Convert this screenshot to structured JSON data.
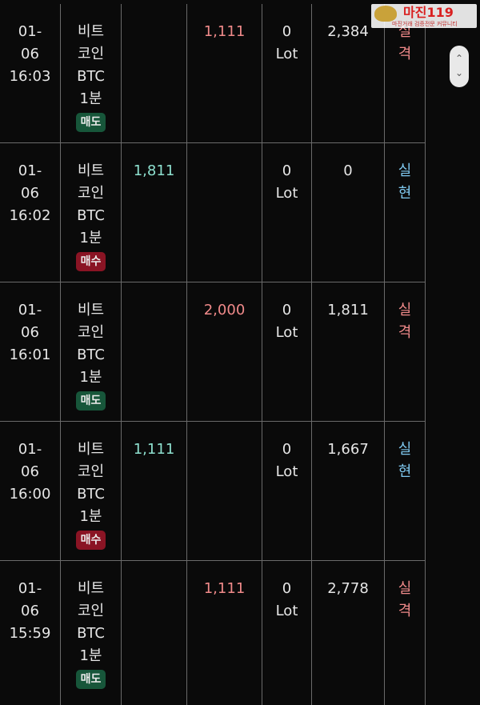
{
  "watermark": {
    "title": "마진119",
    "subtitle": "마진거래 검증전문 커뮤니티"
  },
  "rows": [
    {
      "time": [
        "01-",
        "06",
        "16:03"
      ],
      "name": [
        "비트",
        "코인",
        "BTC",
        "1분"
      ],
      "badge": "매도",
      "buy": "",
      "sell": "1,111",
      "lot": [
        "0",
        "Lot"
      ],
      "amount": "2,384",
      "result": [
        "실",
        "격"
      ]
    },
    {
      "time": [
        "01-",
        "06",
        "16:02"
      ],
      "name": [
        "비트",
        "코인",
        "BTC",
        "1분"
      ],
      "badge": "매수",
      "buy": "1,811",
      "sell": "",
      "lot": [
        "0",
        "Lot"
      ],
      "amount": "0",
      "result": [
        "실",
        "현"
      ]
    },
    {
      "time": [
        "01-",
        "06",
        "16:01"
      ],
      "name": [
        "비트",
        "코인",
        "BTC",
        "1분"
      ],
      "badge": "매도",
      "buy": "",
      "sell": "2,000",
      "lot": [
        "0",
        "Lot"
      ],
      "amount": "1,811",
      "result": [
        "실",
        "격"
      ]
    },
    {
      "time": [
        "01-",
        "06",
        "16:00"
      ],
      "name": [
        "비트",
        "코인",
        "BTC",
        "1분"
      ],
      "badge": "매수",
      "buy": "1,111",
      "sell": "",
      "lot": [
        "0",
        "Lot"
      ],
      "amount": "1,667",
      "result": [
        "실",
        "현"
      ]
    },
    {
      "time": [
        "01-",
        "06",
        "15:59"
      ],
      "name": [
        "비트",
        "코인",
        "BTC",
        "1분"
      ],
      "badge": "매도",
      "buy": "",
      "sell": "1,111",
      "lot": [
        "0",
        "Lot"
      ],
      "amount": "2,778",
      "result": [
        "실",
        "격"
      ]
    }
  ],
  "colors": {
    "background": "#0a0a0a",
    "grid": "#6a6a6a",
    "sell_badge": "#17563a",
    "buy_badge": "#8a1424",
    "buy_value": "#8ee0cf",
    "sell_value": "#f08a8a",
    "result_fail": "#f08a8a",
    "result_real": "#7fc8ef"
  },
  "scrollbar": {
    "up_icon": "chevron-up-icon",
    "down_icon": "chevron-down-icon"
  }
}
